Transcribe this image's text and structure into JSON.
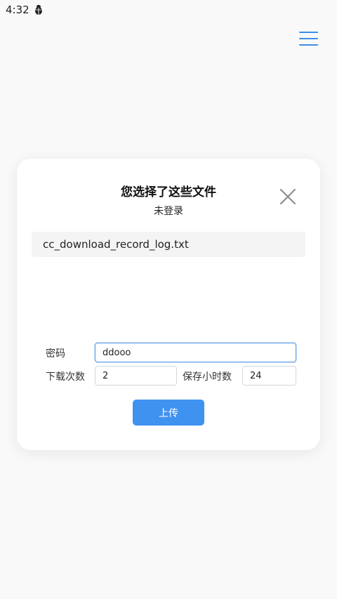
{
  "status_bar": {
    "time": "4:32",
    "notification_icon": "bug-icon"
  },
  "header": {
    "menu_icon": "hamburger-menu-icon",
    "accent_color": "#3a8ee6"
  },
  "dialog": {
    "title": "您选择了这些文件",
    "subtitle": "未登录",
    "close_icon": "close-icon",
    "files": [
      {
        "name": "cc_download_record_log.txt"
      }
    ],
    "form": {
      "password_label": "密码",
      "password_value": "ddooo",
      "download_count_label": "下载次数",
      "download_count_value": "2",
      "keep_hours_label": "保存小时数",
      "keep_hours_value": "24"
    },
    "upload_label": "上传",
    "upload_color": "#4092f0"
  }
}
